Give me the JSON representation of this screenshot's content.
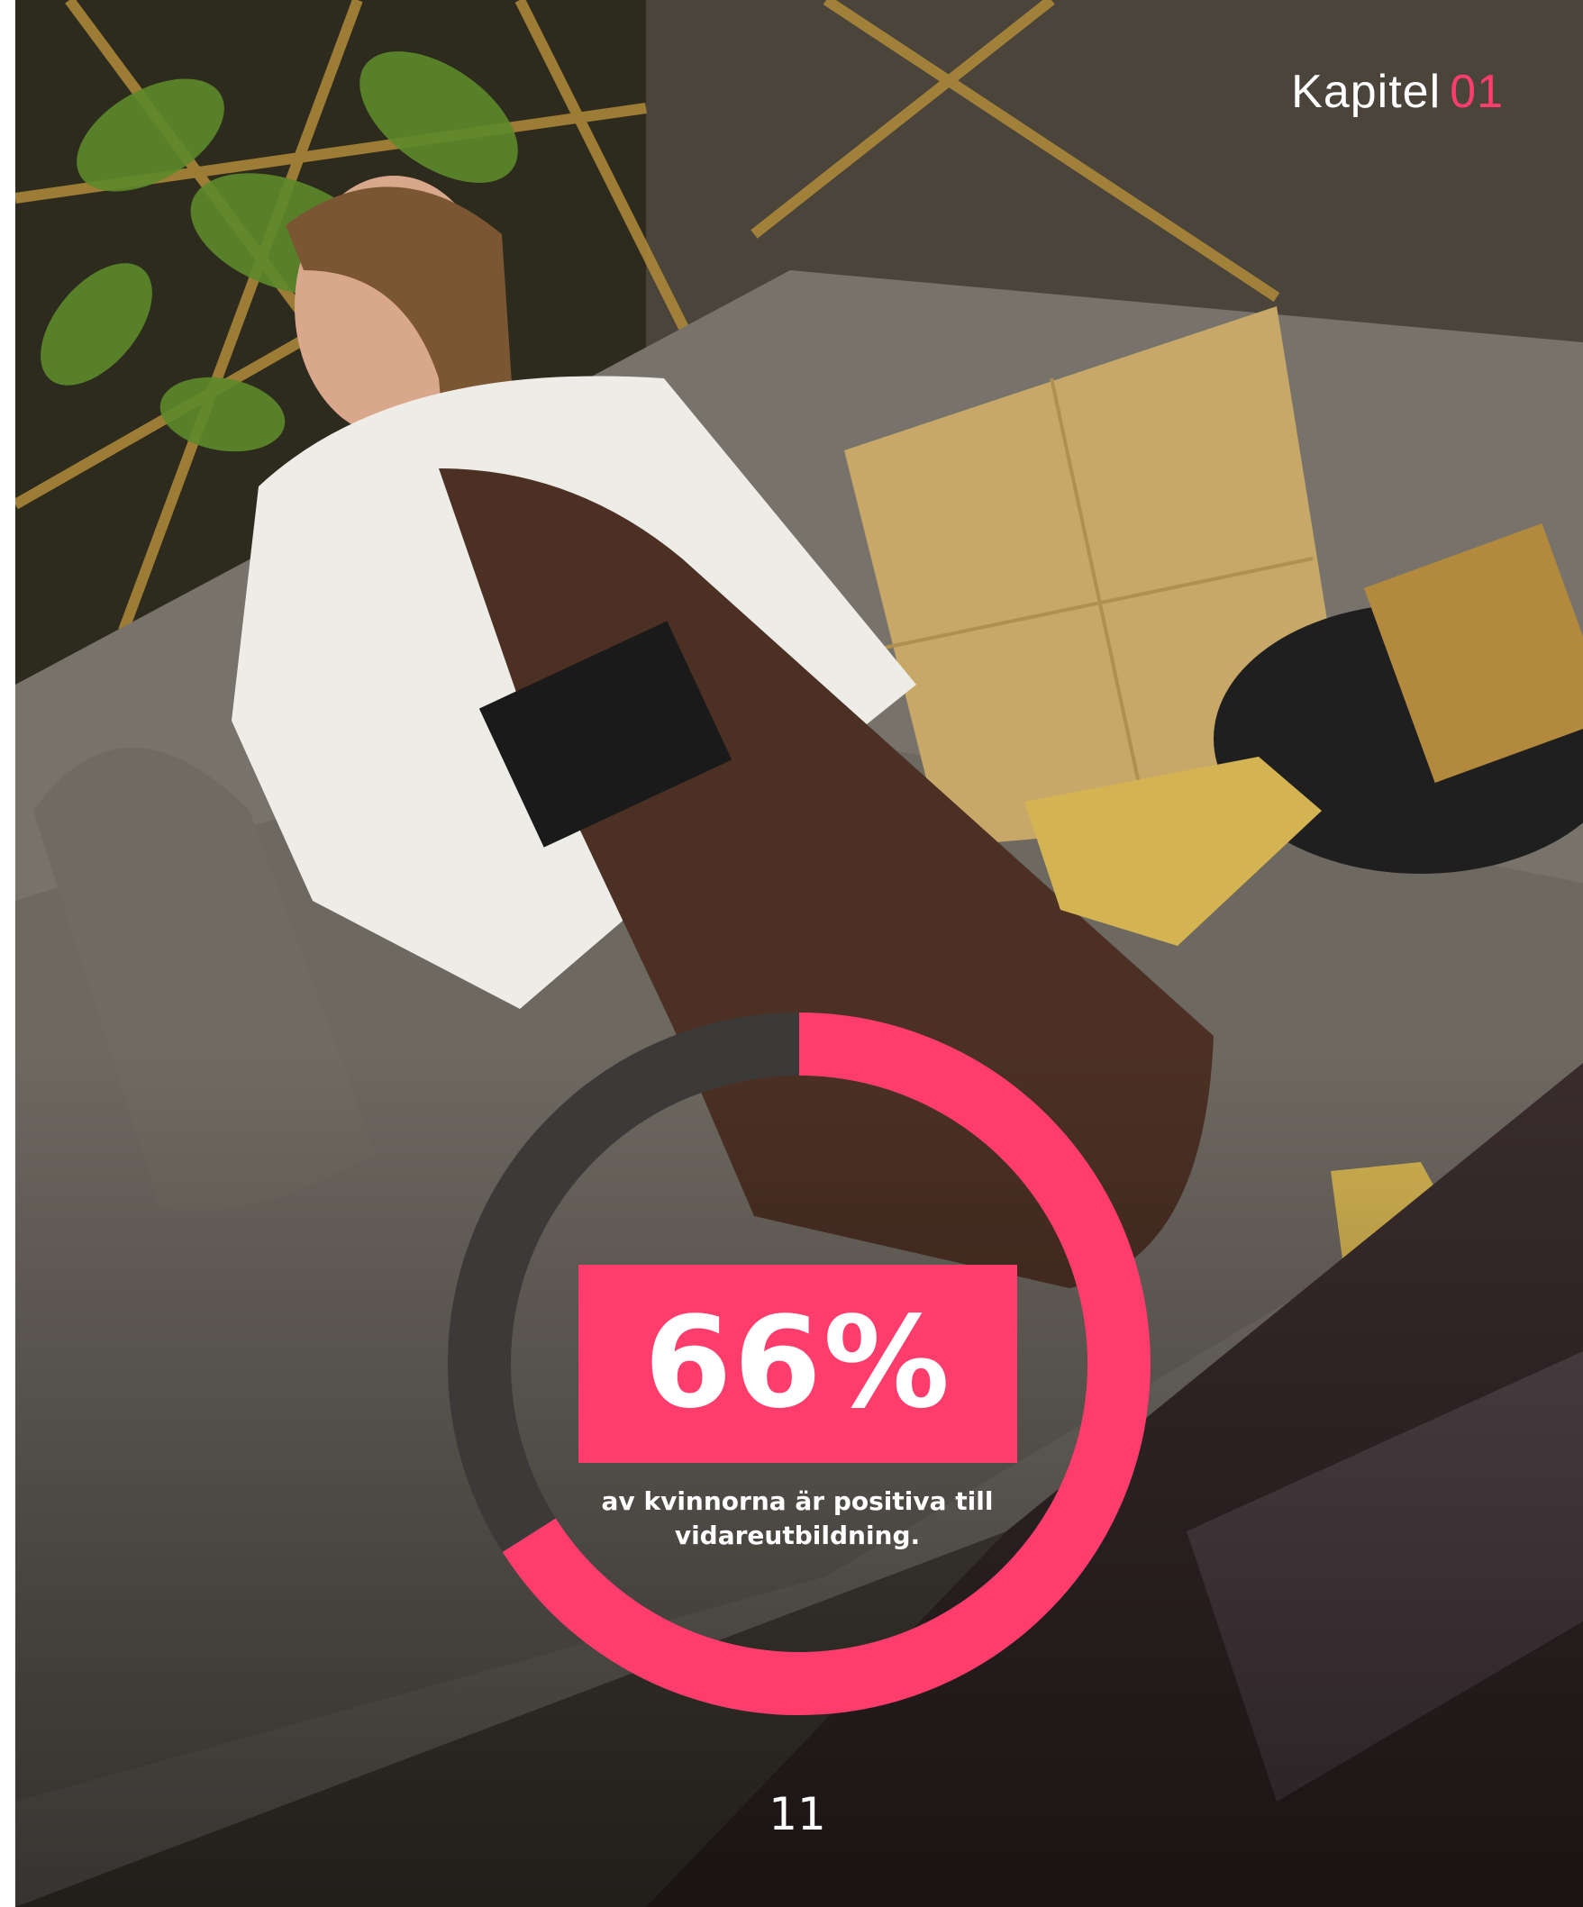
{
  "header": {
    "chapter_label": "Kapitel",
    "chapter_number": "01"
  },
  "photo": {
    "description_icon": "photo-woman-on-sofa"
  },
  "stat": {
    "value_text": "66%",
    "percent": 66,
    "caption": "av kvinnorna är positiva till vidareutbildning."
  },
  "colors": {
    "accent": "#ff3d6c",
    "ring_rest": "#3c3a39"
  },
  "footer": {
    "page_number": "11"
  }
}
